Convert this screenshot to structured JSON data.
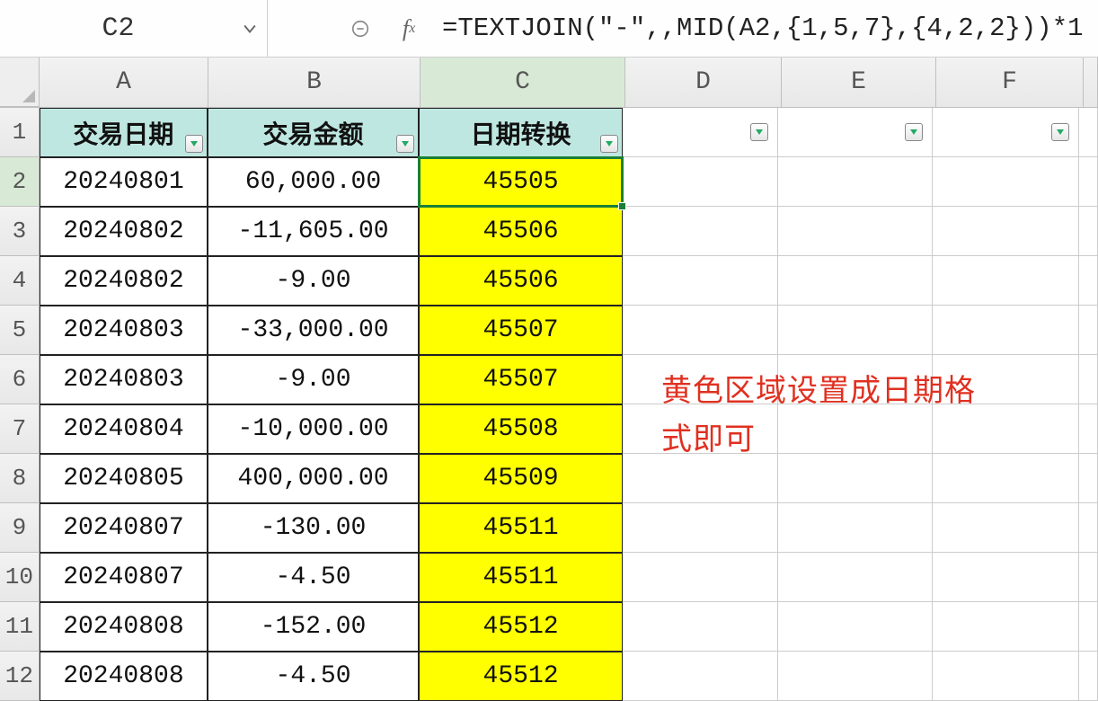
{
  "formula_bar": {
    "cell_ref": "C2",
    "formula": "=TEXTJOIN(\"-\",,MID(A2,{1,5,7},{4,2,2}))*1"
  },
  "columns": [
    "A",
    "B",
    "C",
    "D",
    "E",
    "F"
  ],
  "headers": {
    "a": "交易日期",
    "b": "交易金额",
    "c": "日期转换"
  },
  "rows": [
    {
      "n": "2",
      "a": "20240801",
      "b": "60,000.00",
      "c": "45505"
    },
    {
      "n": "3",
      "a": "20240802",
      "b": "-11,605.00",
      "c": "45506"
    },
    {
      "n": "4",
      "a": "20240802",
      "b": "-9.00",
      "c": "45506"
    },
    {
      "n": "5",
      "a": "20240803",
      "b": "-33,000.00",
      "c": "45507"
    },
    {
      "n": "6",
      "a": "20240803",
      "b": "-9.00",
      "c": "45507"
    },
    {
      "n": "7",
      "a": "20240804",
      "b": "-10,000.00",
      "c": "45508"
    },
    {
      "n": "8",
      "a": "20240805",
      "b": "400,000.00",
      "c": "45509"
    },
    {
      "n": "9",
      "a": "20240807",
      "b": "-130.00",
      "c": "45511"
    },
    {
      "n": "10",
      "a": "20240807",
      "b": "-4.50",
      "c": "45511"
    },
    {
      "n": "11",
      "a": "20240808",
      "b": "-152.00",
      "c": "45512"
    },
    {
      "n": "12",
      "a": "20240808",
      "b": "-4.50",
      "c": "45512"
    }
  ],
  "annotation": {
    "line1": "黄色区域设置成日期格",
    "line2": "式即可"
  },
  "active_cell": "C2",
  "colors": {
    "header_fill": "#bfe7e1",
    "highlight_fill": "#ffff00",
    "selection": "#1a7f37",
    "annotation_text": "#e03020"
  }
}
